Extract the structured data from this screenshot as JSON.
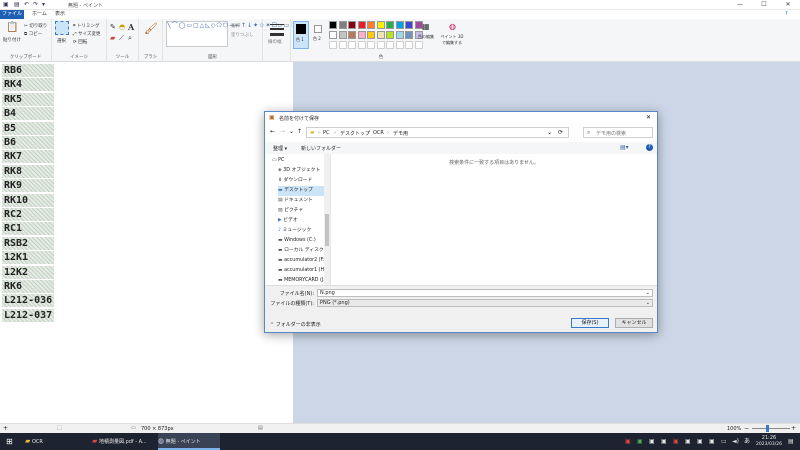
{
  "window": {
    "title": "無題 - ペイント",
    "minimize": "—",
    "maximize": "☐",
    "close": "✕"
  },
  "menu_tabs": [
    "ファイル",
    "ホーム",
    "表示"
  ],
  "ribbon": {
    "clipboard": {
      "paste": "貼り付け",
      "cut": "切り取り",
      "copy": "コピー",
      "label": "クリップボード"
    },
    "image": {
      "select": "選択",
      "crop": "トリミング",
      "resize": "サイズ変更",
      "rotate": "回転",
      "label": "イメージ"
    },
    "tools": {
      "label": "ツール"
    },
    "brushes": {
      "label": "ブラシ"
    },
    "shapes": {
      "outline": "輪郭",
      "fill": "塗りつぶし",
      "label": "図形"
    },
    "size": {
      "label": "線の幅"
    },
    "colors": {
      "color1": "色 1",
      "color2": "色 2",
      "edit": "色の編集",
      "paint3d": "ペイント 3D で編集する",
      "label": "色"
    }
  },
  "palette": [
    "#000000",
    "#7f7f7f",
    "#880015",
    "#ed1c24",
    "#ff7f27",
    "#fff200",
    "#22b14c",
    "#00a2e8",
    "#3f48cc",
    "#a349a4",
    "#ffffff",
    "#c3c3c3",
    "#b97a57",
    "#ffaec9",
    "#ffc90e",
    "#efe4b0",
    "#b5e61d",
    "#99d9ea",
    "#7092be",
    "#c8bfe7"
  ],
  "canvas_items": [
    "RB6",
    "RK4",
    "RK5",
    "B4",
    "B5",
    "B6",
    "RK7",
    "RK8",
    "RK9",
    "RK10",
    "RC2",
    "RC1",
    "RSB2",
    "12K1",
    "12K2",
    "RK6",
    "L212-036",
    "L212-037"
  ],
  "dialog": {
    "title": "名前を付けて保存",
    "close": "✕",
    "breadcrumb": [
      "PC",
      "デスクトップ",
      "OCR",
      "デモ用"
    ],
    "search_placeholder": "デモ用の検索",
    "organize": "整理 ▾",
    "new_folder": "新しいフォルダー",
    "empty_message": "検索条件に一致する項目はありません。",
    "nav_items": [
      "PC",
      "3D オブジェクト",
      "ダウンロード",
      "デスクトップ",
      "ドキュメント",
      "ピクチャ",
      "ビデオ",
      "ミュージック",
      "Windows (C:)",
      "ローカル ディスク (D:)",
      "accumulator2 (F:)",
      "accumulator1 (H:)",
      "MEMORYCARD (J:)"
    ],
    "file_name_label": "ファイル名(N):",
    "file_name_value": "N.png",
    "file_type_label": "ファイルの種類(T):",
    "file_type_value": "PNG (*.png)",
    "hide_folders": "フォルダーの非表示",
    "save": "保存(S)",
    "cancel": "キャンセル"
  },
  "status": {
    "dimensions": "700 × 873px",
    "zoom": "100%"
  },
  "taskbar": {
    "items": [
      "OCR",
      "地積測量図.pdf - A...",
      "無題 - ペイント"
    ],
    "time": "21:26",
    "date": "2023/03/26"
  }
}
